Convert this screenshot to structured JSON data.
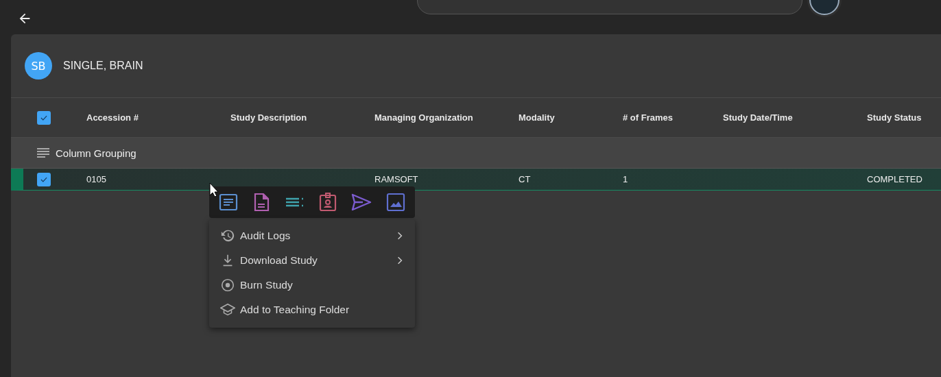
{
  "patient": {
    "initials": "SB",
    "name": "SINGLE, BRAIN"
  },
  "table": {
    "all_checked": true,
    "columns": [
      "Accession #",
      "Study Description",
      "Managing Organization",
      "Modality",
      "# of Frames",
      "Study Date/Time",
      "Study Status"
    ],
    "grouping_label": "Column Grouping",
    "rows": [
      {
        "selected": true,
        "cells": [
          "0105",
          "",
          "RAMSOFT",
          "CT",
          "1",
          "",
          "COMPLETED"
        ]
      }
    ]
  },
  "context_menu": {
    "toolbar": [
      {
        "kind": "report",
        "color": "#5b8fd0"
      },
      {
        "kind": "document",
        "color": "#b060b0"
      },
      {
        "kind": "list",
        "color": "#3fa3ad"
      },
      {
        "kind": "badge",
        "color": "#c05a70"
      },
      {
        "kind": "send",
        "color": "#7c5cd0"
      },
      {
        "kind": "image",
        "color": "#5f6fd0"
      }
    ],
    "items": [
      {
        "kind": "history",
        "label": "Audit Logs",
        "submenu": true
      },
      {
        "kind": "download",
        "label": "Download Study",
        "submenu": true
      },
      {
        "kind": "disc",
        "label": "Burn Study",
        "submenu": false
      },
      {
        "kind": "school",
        "label": "Add to Teaching Folder",
        "submenu": false
      }
    ]
  }
}
